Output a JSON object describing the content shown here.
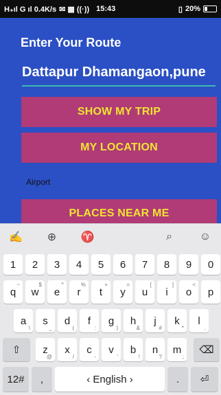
{
  "status": {
    "left": "H₊ıl G ıl 0.4K/s",
    "time": "15:43",
    "right": "20%"
  },
  "app": {
    "title": "Enter Your Route",
    "route_value": "Dattapur Dhamangaon,pune",
    "show_trip": "SHOW MY TRIP",
    "my_location": "MY LOCATION",
    "airport": "Airport",
    "places_near": "PLACES NEAR ME"
  },
  "keyboard": {
    "toolbar_icons": [
      "gesture-icon",
      "globe-icon",
      "shirt-icon",
      "search-icon",
      "emoji-icon"
    ],
    "numbers": [
      "1",
      "2",
      "3",
      "4",
      "5",
      "6",
      "7",
      "8",
      "9",
      "0"
    ],
    "row1": [
      "q",
      "w",
      "e",
      "r",
      "t",
      "y",
      "u",
      "i",
      "o",
      "p"
    ],
    "row1_alt": [
      "~",
      "$",
      "^",
      "%",
      "+",
      "=",
      "[",
      "]",
      "<",
      ""
    ],
    "row2": [
      "a",
      "s",
      "d",
      "f",
      "g",
      "h",
      "j",
      "k",
      "l"
    ],
    "row2_alt": [
      "\\",
      "_",
      "(",
      ":",
      ")",
      "&",
      "#",
      "*",
      "."
    ],
    "row3": [
      "z",
      "x",
      "c",
      "v",
      "b",
      "n",
      "m"
    ],
    "row3_alt": [
      "@",
      "/",
      "-",
      "'",
      "!",
      "?",
      ";"
    ],
    "num_label": "12#",
    "comma_label": ",",
    "space_label": "English",
    "period_label": ".",
    "enter_label": "⏎"
  }
}
